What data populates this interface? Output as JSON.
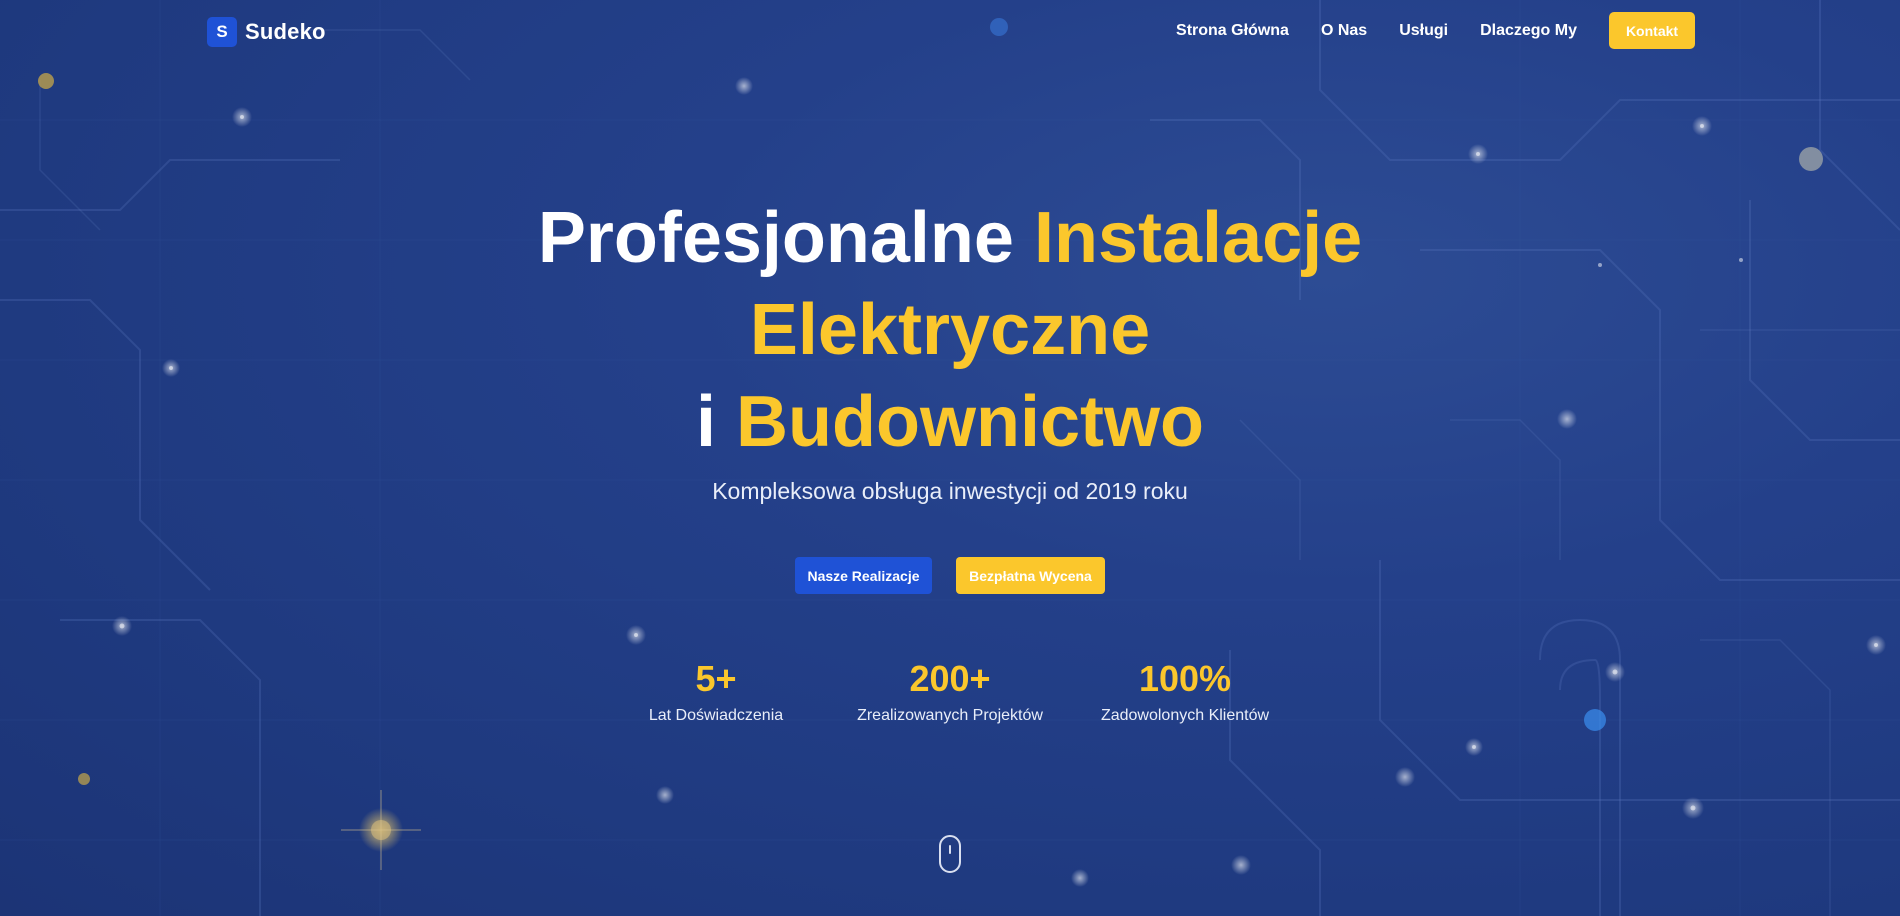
{
  "brand": {
    "logo_letter": "S",
    "name": "Sudeko"
  },
  "nav": {
    "items": [
      {
        "label": "Strona Główna"
      },
      {
        "label": "O Nas"
      },
      {
        "label": "Usługi"
      },
      {
        "label": "Dlaczego My"
      }
    ],
    "cta_label": "Kontakt"
  },
  "hero": {
    "headline_line1_white": "Profesjonalne",
    "headline_line1_accent": "Instalacje",
    "headline_line2_accent": "Elektryczne",
    "headline_line3_white": "i",
    "headline_line3_accent": "Budownictwo",
    "subtitle": "Kompleksowa obsługa inwestycji od 2019 roku",
    "primary_button": "Nasze Realizacje",
    "secondary_button": "Bezpłatna Wycena"
  },
  "stats": [
    {
      "value": "5+",
      "label": "Lat Doświadczenia"
    },
    {
      "value": "200+",
      "label": "Zrealizowanych Projektów"
    },
    {
      "value": "100%",
      "label": "Zadowolonych Klientów"
    }
  ],
  "icons": {
    "scroll": "mouse-scroll-icon"
  },
  "colors": {
    "background": "#24408a",
    "accent": "#fbc72c",
    "primary": "#1f52d6",
    "text": "#ffffff"
  }
}
